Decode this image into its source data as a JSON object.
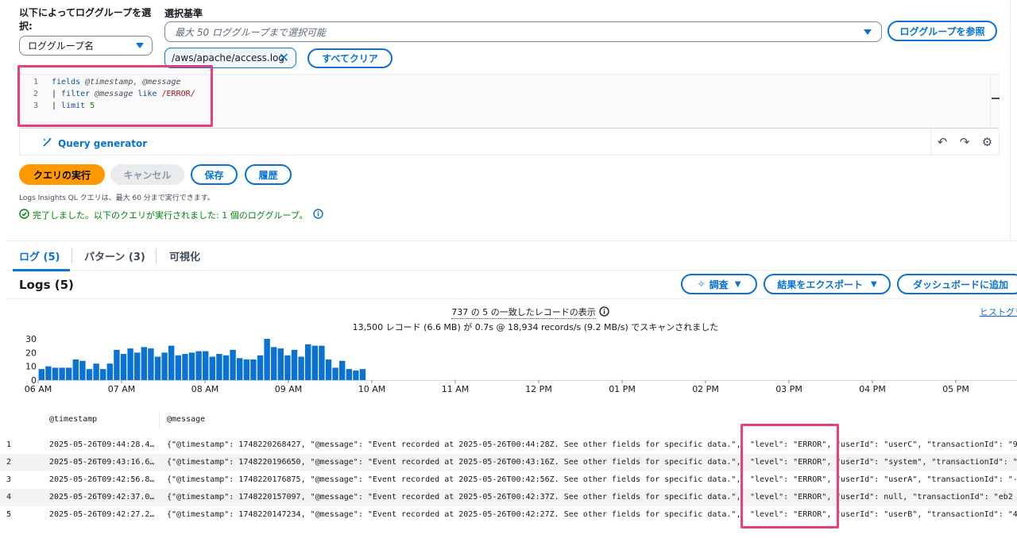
{
  "selector": {
    "label": "以下によってロググループを選択:",
    "dropdown_value": "ロググループ名"
  },
  "criteria": {
    "label": "選択基準",
    "placeholder": "最大 50 ロググループまで選択可能",
    "browse_button": "ロググループを参照",
    "token": "/aws/apache/access.log",
    "clear_button": "すべてクリア"
  },
  "editor": {
    "line_numbers": [
      "1",
      "2",
      "3"
    ],
    "line1": {
      "kw": "fields",
      "rest": " @timestamp, @message"
    },
    "line2": {
      "pipe": "| ",
      "kw": "filter",
      "field": " @message ",
      "op": "like",
      "regex": " /ERROR/"
    },
    "line3": {
      "pipe": "| ",
      "kw": "limit",
      "num": " 5"
    }
  },
  "query_generator": {
    "label": "Query generator"
  },
  "actions": {
    "run": "クエリの実行",
    "cancel": "キャンセル",
    "save": "保存",
    "history": "履歴"
  },
  "hint": "Logs Insights QL クエリは、最大 60 分まで実行できます。",
  "status": "完了しました。以下のクエリが実行されました: 1 個のロググループ。",
  "tabs": [
    {
      "label": "ログ (5)"
    },
    {
      "label": "パターン (3)"
    },
    {
      "label": "可視化"
    }
  ],
  "logs_panel": {
    "title": "Logs (5)",
    "investigate": "調査",
    "export": "結果をエクスポート",
    "dashboard": "ダッシュボードに追加",
    "records": "737 の 5 の一致したレコードの表示",
    "scan": "13,500 レコード (6.6 MB) が 0.7s @ 18,934 records/s (9.2 MB/s) でスキャンされました",
    "histogram_link": "ヒストグラ"
  },
  "chart_data": {
    "type": "bar",
    "y_ticks": [
      "30",
      "20",
      "10",
      "0"
    ],
    "ylim": [
      0,
      30
    ],
    "x_tick_labels": [
      "06 AM",
      "07 AM",
      "08 AM",
      "09 AM",
      "10 AM",
      "11 AM",
      "12 PM",
      "01 PM",
      "02 PM",
      "03 PM",
      "04 PM",
      "05 PM"
    ],
    "values": [
      8,
      10,
      9,
      9,
      9,
      15,
      14,
      8,
      12,
      8,
      12,
      22,
      19,
      23,
      20,
      24,
      23,
      17,
      20,
      25,
      18,
      19,
      20,
      21,
      21,
      17,
      19,
      18,
      22,
      16,
      15,
      15,
      18,
      30,
      24,
      23,
      18,
      22,
      17,
      26,
      25,
      25,
      15,
      9,
      14,
      8,
      7,
      8
    ],
    "bar_color": "#0972d3"
  },
  "table": {
    "headers": {
      "timestamp": "@timestamp",
      "message": "@message"
    },
    "rows": [
      {
        "idx": "1",
        "ts": "2025-05-26T09:44:28.4…",
        "msg": "{\"@timestamp\": 1748220268427, \"@message\": \"Event recorded at 2025-05-26T00:44:28Z. See other fields for specific data.\",",
        "level": "\"level\": \"ERROR\",",
        "rest": "\"userId\": \"userC\", \"transactionId\": \"9"
      },
      {
        "idx": "2",
        "ts": "2025-05-26T09:43:16.6…",
        "msg": "{\"@timestamp\": 1748220196650, \"@message\": \"Event recorded at 2025-05-26T00:43:16Z. See other fields for specific data.\",",
        "level": "\"level\": \"ERROR\",",
        "rest": "\"userId\": \"system\", \"transactionId\": \""
      },
      {
        "idx": "3",
        "ts": "2025-05-26T09:42:56.8…",
        "msg": "{\"@timestamp\": 1748220176875, \"@message\": \"Event recorded at 2025-05-26T00:42:56Z. See other fields for specific data.\",",
        "level": "\"level\": \"ERROR\",",
        "rest": "\"userId\": \"userA\", \"transactionId\": \"-"
      },
      {
        "idx": "4",
        "ts": "2025-05-26T09:42:37.0…",
        "msg": "{\"@timestamp\": 1748220157097, \"@message\": \"Event recorded at 2025-05-26T00:42:37Z. See other fields for specific data.\",",
        "level": "\"level\": \"ERROR\",",
        "rest": "\"userId\": null, \"transactionId\": \"eb2"
      },
      {
        "idx": "5",
        "ts": "2025-05-26T09:42:27.2…",
        "msg": "{\"@timestamp\": 1748220147234, \"@message\": \"Event recorded at 2025-05-26T00:42:27Z. See other fields for specific data.\",",
        "level": "\"level\": \"ERROR\",",
        "rest": "\"userId\": \"userB\", \"transactionId\": \"4"
      }
    ]
  }
}
